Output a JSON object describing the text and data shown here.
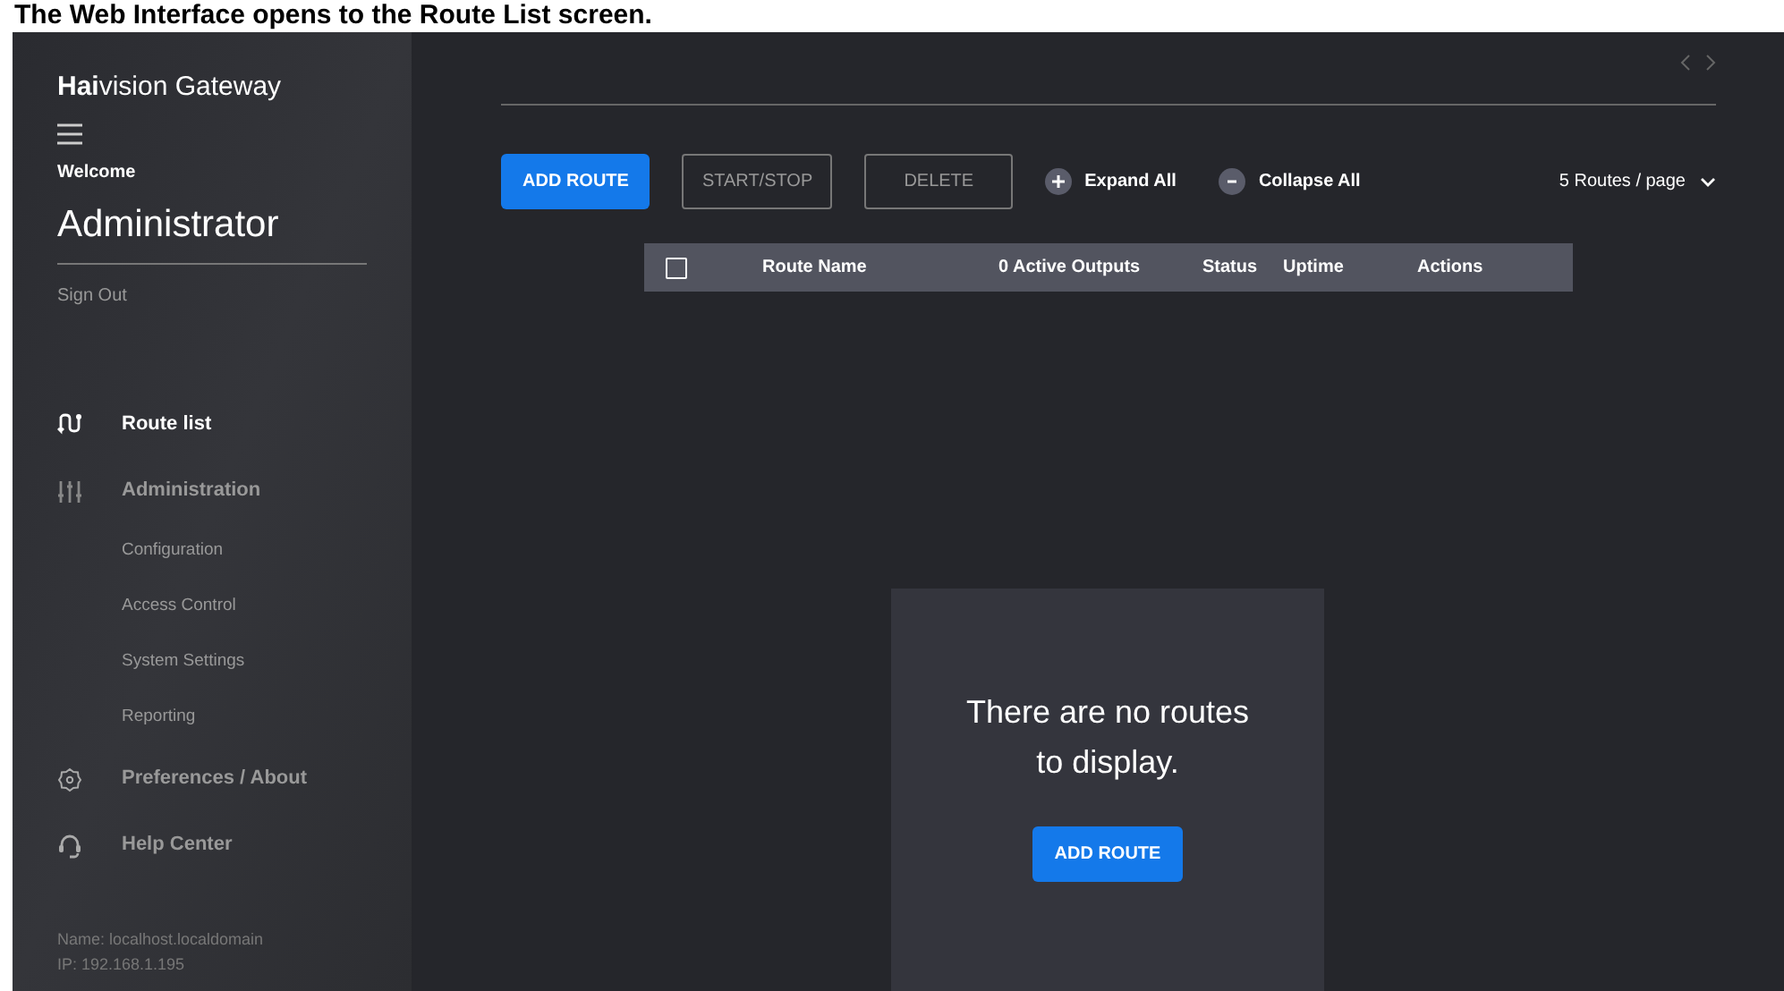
{
  "caption": "The Web Interface opens to the Route List screen.",
  "sidebar": {
    "brand": "**Hai**vision Gateway",
    "welcome": "Welcome",
    "user": "Administrator",
    "sign_out": "Sign Out",
    "items": [
      {
        "kind": "section",
        "label": "Route list",
        "selected": true
      },
      {
        "kind": "section",
        "label": "Administration",
        "selected": false
      },
      {
        "kind": "sub",
        "label": "Configuration",
        "selected": false
      },
      {
        "kind": "sub",
        "label": "Access Control",
        "selected": false
      },
      {
        "kind": "sub",
        "label": "System Settings",
        "selected": false
      },
      {
        "kind": "sub",
        "label": "Reporting",
        "selected": false
      },
      {
        "kind": "section",
        "label": "Preferences / About",
        "selected": false
      },
      {
        "kind": "section",
        "label": "Help Center",
        "selected": false
      }
    ],
    "footer": [
      "Name: localhost.localdomain",
      "IP: 192.168.1.195"
    ]
  },
  "toolbar": {
    "add": "ADD ROUTE",
    "start_stop": "START/STOP",
    "delete": "DELETE",
    "expand": "Expand All",
    "collapse": "Collapse All",
    "per_page": "5 Routes / page"
  },
  "table": {
    "select_all_checked": false,
    "columns": [
      "Route Name",
      "0 Active Outputs",
      "Status",
      "Uptime",
      "Actions"
    ]
  },
  "empty": {
    "message": "There are no routes to display.",
    "button": "ADD ROUTE"
  }
}
